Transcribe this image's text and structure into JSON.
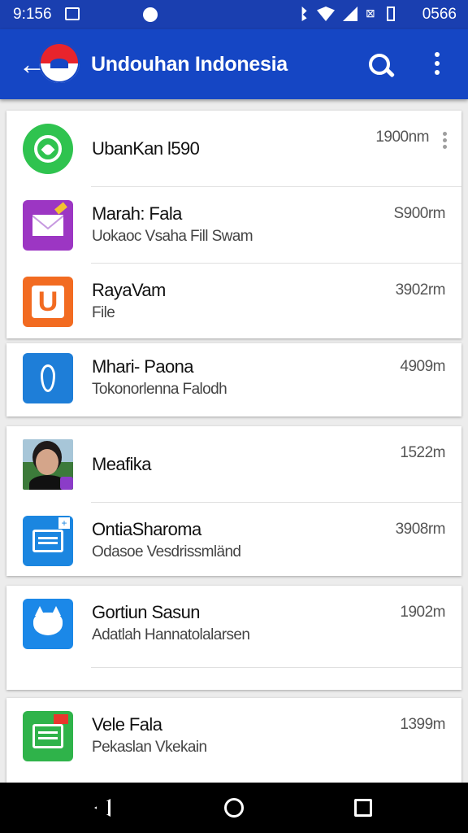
{
  "status_bar": {
    "time": "9:156",
    "right_text": "0566",
    "icons": [
      "image-icon",
      "notification-dot-icon",
      "bluetooth-icon",
      "wifi-icon",
      "signal-icon",
      "data-icon",
      "battery-icon"
    ]
  },
  "app_bar": {
    "title": "Undouhan Indonesia",
    "back_icon": "arrow-left-icon",
    "search_icon": "search-icon",
    "more_icon": "more-vert-icon",
    "color": "#1546c4"
  },
  "items": [
    {
      "title": "UbanKan l590",
      "subtitle": "",
      "size": "1900nm",
      "icon": "whatsapp-icon"
    },
    {
      "title": "Marah: Fala",
      "subtitle": "Uokaoc Vsaha Fill Swam",
      "size": "S900rm",
      "icon": "mail-icon"
    },
    {
      "title": "RayaVam",
      "subtitle": "File",
      "size": "3902rm",
      "icon": "u-app-icon"
    },
    {
      "title": "Mhari- Paona",
      "subtitle": "Tokonorlenna Falodh",
      "size": "4909m",
      "icon": "pen-nib-icon"
    },
    {
      "title": "Meafika",
      "subtitle": "",
      "size": "1522m",
      "icon": "profile-photo-icon"
    },
    {
      "title": "OntiaSharoma",
      "subtitle": "Odasoe Vesdrissmländ",
      "size": "3908rm",
      "icon": "card-icon"
    },
    {
      "title": "Gortiun Sasun",
      "subtitle": "Adatlah Hannatolalarsen",
      "size": "1902m",
      "icon": "cat-icon"
    },
    {
      "title": "Vele Fala",
      "subtitle": "Pekaslan Vkekain",
      "size": "1399m",
      "icon": "sheet-icon"
    }
  ],
  "nav_bar": {
    "icons": [
      "nav-back-icon",
      "nav-home-icon",
      "nav-recents-icon"
    ]
  }
}
